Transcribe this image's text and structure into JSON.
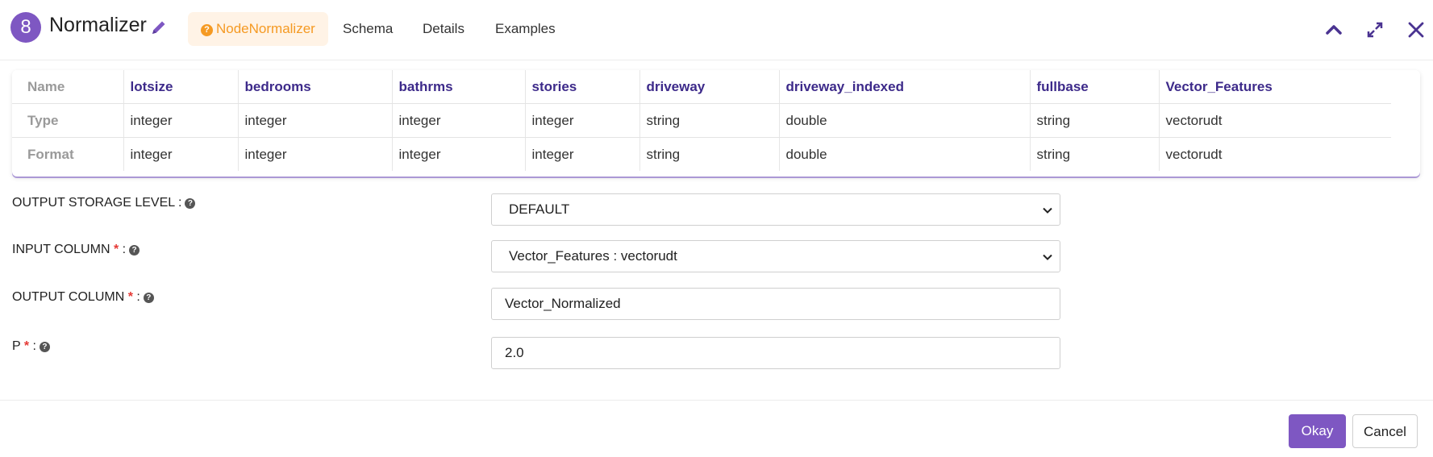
{
  "header": {
    "node_number": "8",
    "title": "Normalizer",
    "tabs": [
      {
        "label": "NodeNormalizer",
        "active": true
      },
      {
        "label": "Schema",
        "active": false
      },
      {
        "label": "Details",
        "active": false
      },
      {
        "label": "Examples",
        "active": false
      }
    ],
    "accent_color": "#7e57c2",
    "active_tab_color": "#f59a23"
  },
  "schema_table": {
    "row_headers": [
      "Name",
      "Type",
      "Format"
    ],
    "columns": [
      {
        "name": "lotsize",
        "type": "integer",
        "format": "integer"
      },
      {
        "name": "bedrooms",
        "type": "integer",
        "format": "integer"
      },
      {
        "name": "bathrms",
        "type": "integer",
        "format": "integer"
      },
      {
        "name": "stories",
        "type": "integer",
        "format": "integer"
      },
      {
        "name": "driveway",
        "type": "string",
        "format": "string"
      },
      {
        "name": "driveway_indexed",
        "type": "double",
        "format": "double"
      },
      {
        "name": "fullbase",
        "type": "string",
        "format": "string"
      },
      {
        "name": "Vector_Features",
        "type": "vectorudt",
        "format": "vectorudt"
      }
    ]
  },
  "form": {
    "output_storage_level": {
      "label": "OUTPUT STORAGE LEVEL",
      "value": "DEFAULT"
    },
    "input_column": {
      "label": "INPUT COLUMN",
      "value": "Vector_Features : vectorudt"
    },
    "output_column": {
      "label": "OUTPUT COLUMN",
      "value": "Vector_Normalized"
    },
    "p": {
      "label": "P",
      "value": "2.0"
    }
  },
  "footer": {
    "okay_label": "Okay",
    "cancel_label": "Cancel"
  }
}
